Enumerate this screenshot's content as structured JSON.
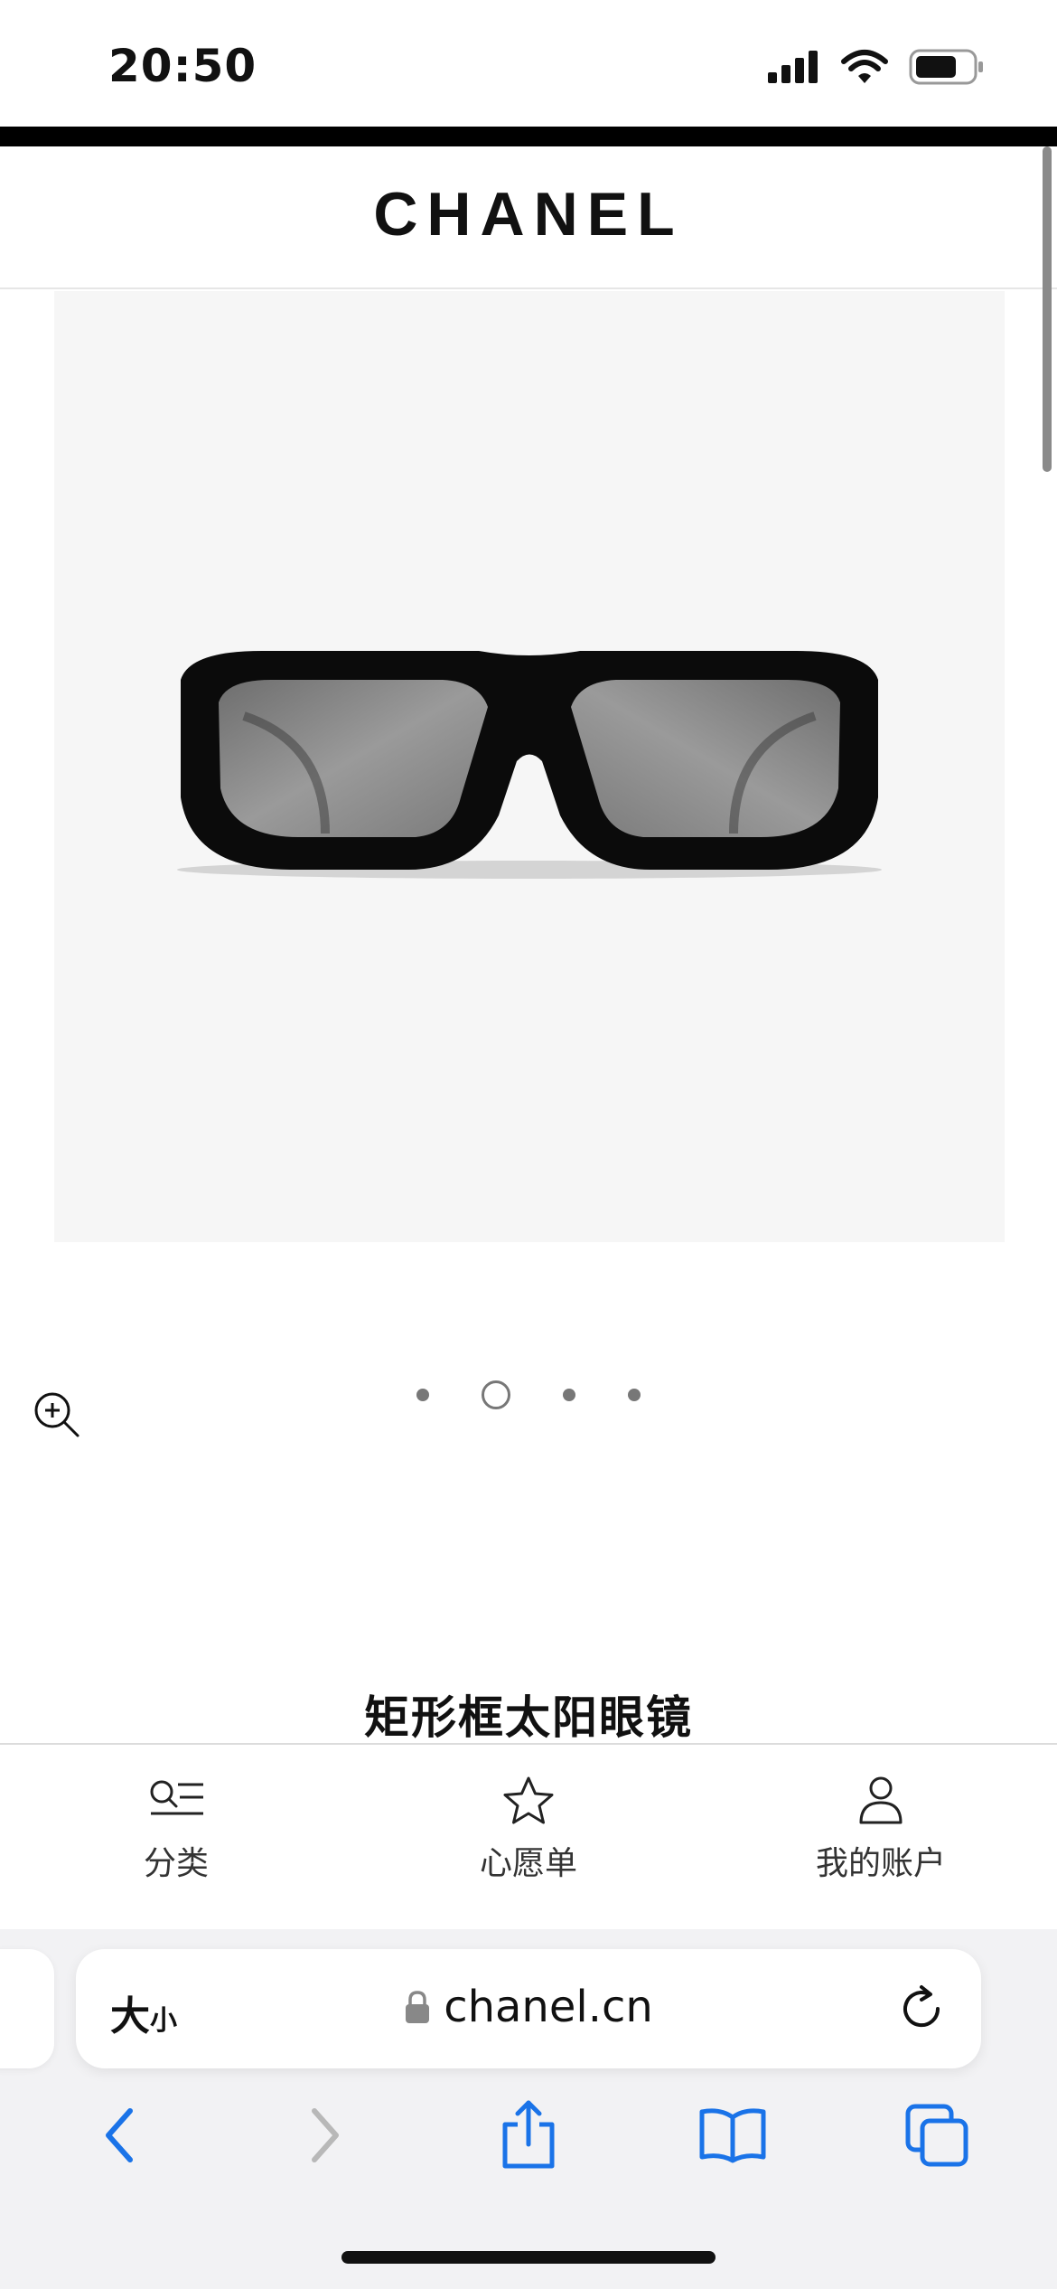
{
  "status_bar": {
    "time": "20:50",
    "icons": [
      "cellular-signal-icon",
      "wifi-icon",
      "battery-icon"
    ]
  },
  "header": {
    "brand": "CHANEL"
  },
  "product": {
    "image": "sunglasses-image",
    "title": "矩形框太阳眼镜"
  },
  "carousel": {
    "count": 4,
    "active_index": 1
  },
  "tab_bar": {
    "tabs": [
      {
        "label": "分类",
        "icon": "category-list-icon"
      },
      {
        "label": "心愿单",
        "icon": "star-icon"
      },
      {
        "label": "我的账户",
        "icon": "person-icon"
      }
    ]
  },
  "browser": {
    "text_size_label": "大",
    "text_size_small": "小",
    "url": "chanel.cn"
  },
  "colors": {
    "accent_blue": "#1a73e8",
    "disabled_gray": "#b8b8b8"
  }
}
